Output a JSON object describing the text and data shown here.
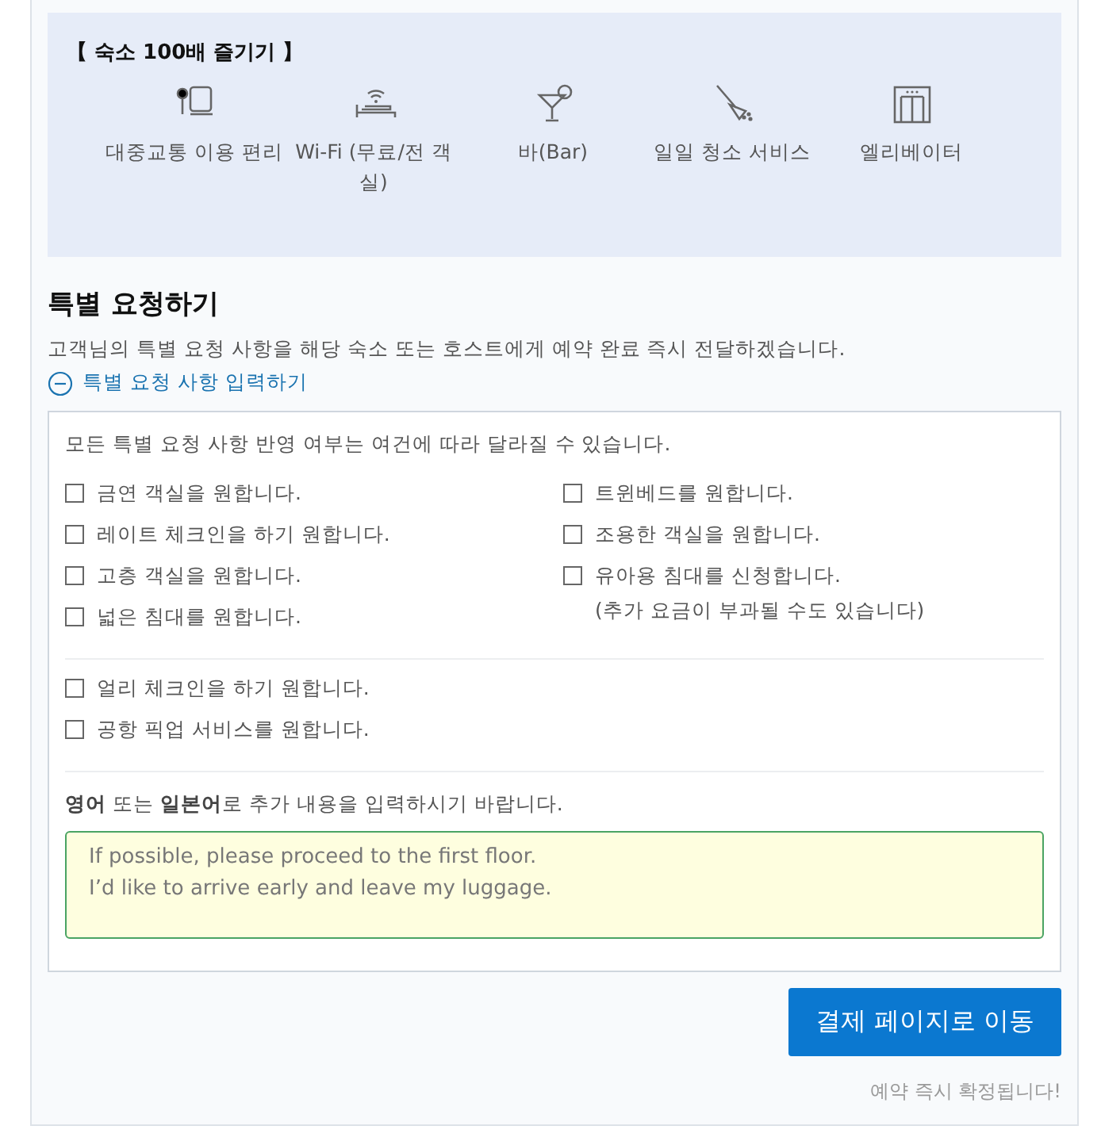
{
  "amenities": {
    "title": "【 숙소 100배 즐기기 】",
    "items": [
      {
        "kind": "transit",
        "label": "대중교통 이용 편리"
      },
      {
        "kind": "wifi",
        "label": "Wi-Fi (무료/전 객실)"
      },
      {
        "kind": "bar",
        "label": "바(Bar)"
      },
      {
        "kind": "cleaning",
        "label": "일일 청소 서비스"
      },
      {
        "kind": "elevator",
        "label": "엘리베이터"
      }
    ]
  },
  "special_requests": {
    "heading": "특별 요청하기",
    "description": "고객님의 특별 요청 사항을 해당 숙소 또는 호스트에게 예약 완료 즉시 전달하겠습니다.",
    "toggle": {
      "label": "특별 요청 사항 입력하기",
      "expanded": true
    },
    "notice": "모든 특별 요청 사항 반영 여부는 여건에 따라 달라질 수 있습니다.",
    "left_options": [
      {
        "label": "금연 객실을 원합니다.",
        "checked": false
      },
      {
        "label": "레이트 체크인을 하기 원합니다.",
        "checked": false
      },
      {
        "label": "고층 객실을 원합니다.",
        "checked": false
      },
      {
        "label": "넓은 침대를 원합니다.",
        "checked": false
      }
    ],
    "right_options": [
      {
        "label": "트윈베드를 원합니다.",
        "checked": false
      },
      {
        "label": "조용한 객실을 원합니다.",
        "checked": false
      },
      {
        "label": "유아용 침대를 신청합니다.",
        "note": "(추가 요금이 부과될 수도 있습니다)",
        "checked": false
      }
    ],
    "extra_options": [
      {
        "label": "얼리 체크인을 하기 원합니다.",
        "checked": false
      },
      {
        "label": "공항 픽업 서비스를 원합니다.",
        "checked": false
      }
    ],
    "comment_prompt": "**영어** 또는 **일본어**로 추가 내용을 입력하시기 바랍니다.",
    "comment": {
      "value": "If possible, please proceed to the first floor.\nI’d like to arrive early and leave my luggage."
    }
  },
  "checkout_button": "결제 페이지로 이동",
  "confirmation_note": "예약 즉시 확정됩니다!"
}
